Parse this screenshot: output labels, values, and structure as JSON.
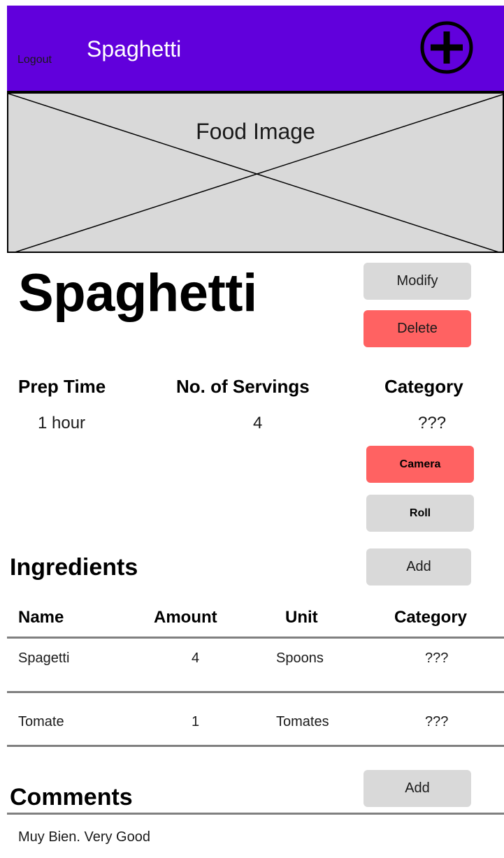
{
  "header": {
    "logout_label": "Logout",
    "title": "Spaghetti",
    "add_icon": "plus-circle-icon",
    "background_color": "#6100dc"
  },
  "image_placeholder": {
    "label": "Food Image"
  },
  "recipe": {
    "title": "Spaghetti",
    "modify_label": "Modify",
    "delete_label": "Delete",
    "info_headers": [
      "Prep Time",
      "No. of Servings",
      "Category"
    ],
    "prep_time": "1 hour",
    "servings": "4",
    "category": "???",
    "camera_label": "Camera",
    "roll_label": "Roll"
  },
  "ingredients": {
    "title": "Ingredients",
    "add_label": "Add",
    "columns": [
      "Name",
      "Amount",
      "Unit",
      "Category"
    ],
    "rows": [
      {
        "name": "Spagetti",
        "amount": "4",
        "unit": "Spoons",
        "category": "???"
      },
      {
        "name": "Tomate",
        "amount": "1",
        "unit": "Tomates",
        "category": "???"
      }
    ]
  },
  "comments": {
    "title": "Comments",
    "add_label": "Add",
    "items": [
      "Muy Bien. Very Good"
    ]
  },
  "colors": {
    "accent_red": "#ff6262",
    "button_grey": "#d9d9d9",
    "placeholder_grey": "#d9d9d9"
  }
}
